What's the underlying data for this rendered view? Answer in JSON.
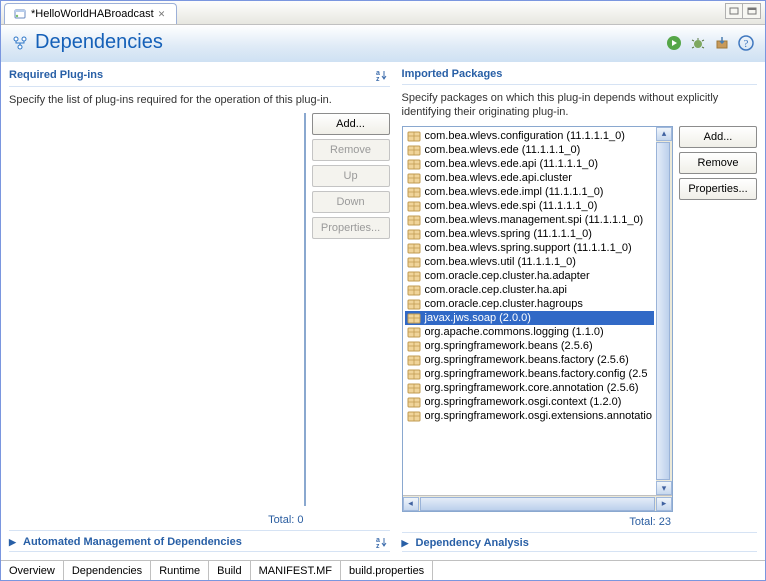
{
  "tab": {
    "title": "*HelloWorldHABroadcast"
  },
  "header": {
    "title": "Dependencies"
  },
  "requiredPlugins": {
    "title": "Required Plug-ins",
    "desc": "Specify the list of plug-ins required for the operation of this plug-in.",
    "addLabel": "Add...",
    "removeLabel": "Remove",
    "upLabel": "Up",
    "downLabel": "Down",
    "propsLabel": "Properties...",
    "total": "Total: 0"
  },
  "autoDeps": {
    "title": "Automated Management of Dependencies"
  },
  "importedPackages": {
    "title": "Imported Packages",
    "desc": "Specify packages on which this plug-in depends without explicitly identifying their originating plug-in.",
    "addLabel": "Add...",
    "removeLabel": "Remove",
    "propsLabel": "Properties...",
    "total": "Total: 23",
    "items": [
      "com.bea.wlevs.configuration (11.1.1.1_0)",
      "com.bea.wlevs.ede (11.1.1.1_0)",
      "com.bea.wlevs.ede.api (11.1.1.1_0)",
      "com.bea.wlevs.ede.api.cluster",
      "com.bea.wlevs.ede.impl (11.1.1.1_0)",
      "com.bea.wlevs.ede.spi (11.1.1.1_0)",
      "com.bea.wlevs.management.spi (11.1.1.1_0)",
      "com.bea.wlevs.spring (11.1.1.1_0)",
      "com.bea.wlevs.spring.support (11.1.1.1_0)",
      "com.bea.wlevs.util (11.1.1.1_0)",
      "com.oracle.cep.cluster.ha.adapter",
      "com.oracle.cep.cluster.ha.api",
      "com.oracle.cep.cluster.hagroups",
      "javax.jws.soap (2.0.0)",
      "org.apache.commons.logging (1.1.0)",
      "org.springframework.beans (2.5.6)",
      "org.springframework.beans.factory (2.5.6)",
      "org.springframework.beans.factory.config (2.5",
      "org.springframework.core.annotation (2.5.6)",
      "org.springframework.osgi.context (1.2.0)",
      "org.springframework.osgi.extensions.annotatio"
    ],
    "selectedIndex": 13
  },
  "depAnalysis": {
    "title": "Dependency Analysis"
  },
  "bottomTabs": [
    "Overview",
    "Dependencies",
    "Runtime",
    "Build",
    "MANIFEST.MF",
    "build.properties"
  ],
  "activeBottomTab": 1
}
